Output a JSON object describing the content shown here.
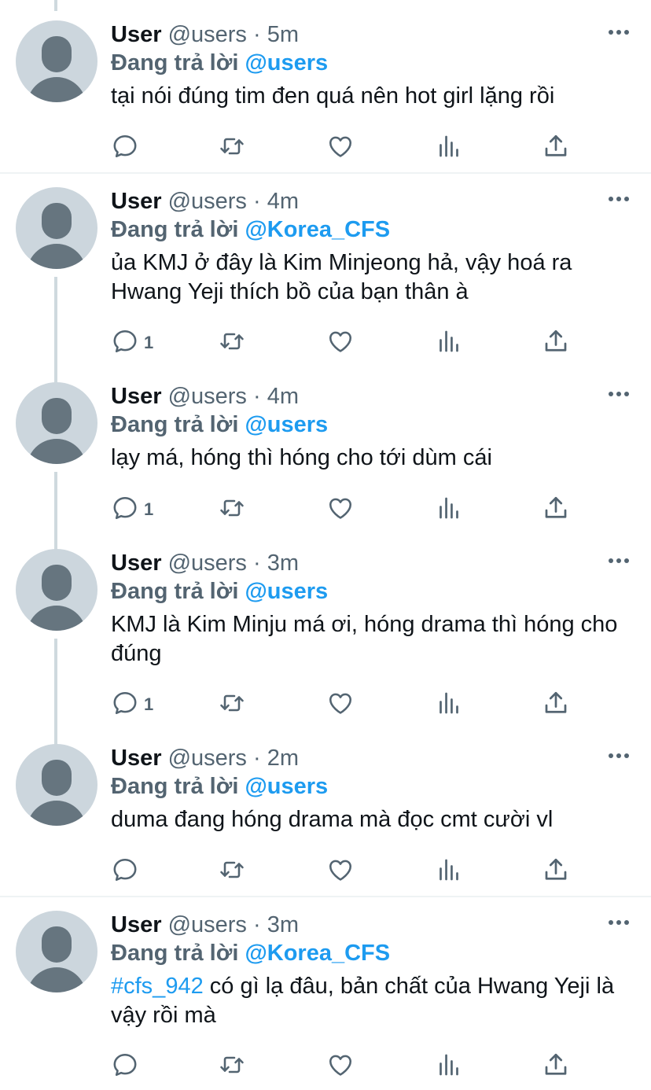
{
  "colors": {
    "text": "#0f1419",
    "secondary": "#536471",
    "accent": "#1d9bf0",
    "avatar_bg": "#ccd6dd",
    "avatar_fg": "#66757f",
    "thread_line": "#cfd9de",
    "divider": "#eff3f4"
  },
  "reply_prefix": "Đang trả lời",
  "tweets": [
    {
      "name": "User",
      "handle": "@users",
      "separator": "·",
      "time": "5m",
      "reply_to": "@users",
      "hashtag": "",
      "text": "tại nói đúng tim đen quá nên hot girl lặng rồi",
      "reply_count": ""
    },
    {
      "name": "User",
      "handle": "@users",
      "separator": "·",
      "time": "4m",
      "reply_to": "@Korea_CFS",
      "hashtag": "",
      "text": "ủa KMJ ở đây là Kim Minjeong hả, vậy hoá ra Hwang Yeji thích bồ của bạn thân à",
      "reply_count": "1"
    },
    {
      "name": "User",
      "handle": "@users",
      "separator": "·",
      "time": "4m",
      "reply_to": "@users",
      "hashtag": "",
      "text": "lạy má, hóng thì hóng cho tới dùm cái",
      "reply_count": "1"
    },
    {
      "name": "User",
      "handle": "@users",
      "separator": "·",
      "time": "3m",
      "reply_to": "@users",
      "hashtag": "",
      "text": "KMJ là Kim Minju má ơi, hóng drama thì hóng cho đúng",
      "reply_count": "1"
    },
    {
      "name": "User",
      "handle": "@users",
      "separator": "·",
      "time": "2m",
      "reply_to": "@users",
      "hashtag": "",
      "text": "duma đang hóng drama mà đọc cmt cười vl",
      "reply_count": ""
    },
    {
      "name": "User",
      "handle": "@users",
      "separator": "·",
      "time": "3m",
      "reply_to": "@Korea_CFS",
      "hashtag": "#cfs_942",
      "text": " có gì lạ đâu, bản chất của Hwang Yeji là vậy rồi mà",
      "reply_count": ""
    }
  ],
  "icons": {
    "reply": "comment-icon",
    "retweet": "retweet-icon",
    "like": "heart-icon",
    "stats": "analytics-icon",
    "share": "share-icon",
    "more": "more-horizontal-icon"
  }
}
